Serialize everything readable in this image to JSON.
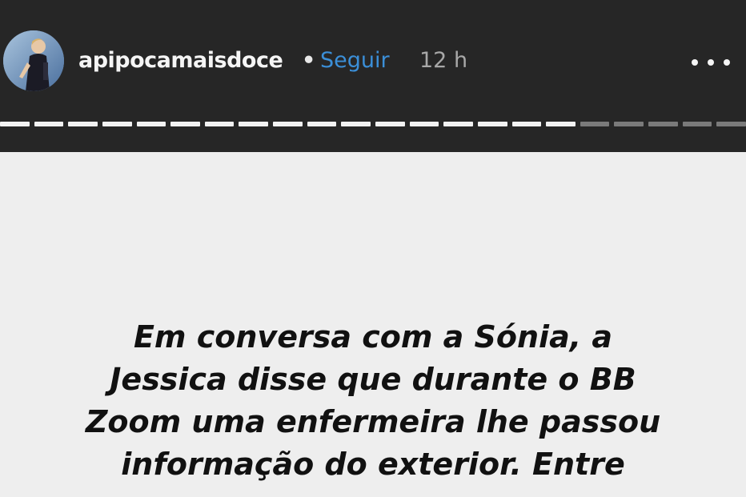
{
  "header": {
    "username": "apipocamaisdoce",
    "separator": "•",
    "follow_label": "Seguir",
    "time": "12 h",
    "more_icon": "more-horizontal-icon"
  },
  "progress": {
    "total_segments": 22,
    "viewed_segments": 17
  },
  "story": {
    "lines": [
      "Em conversa com a Sónia, a",
      "Jessica disse que durante o BB",
      "Zoom uma enfermeira lhe passou",
      "informação do exterior. Entre"
    ]
  },
  "colors": {
    "background": "#262626",
    "story_background": "#eeeeee",
    "follow": "#3b8fd8",
    "progress_viewed": "#f2f2f2",
    "progress_unviewed": "#7a7a7a"
  }
}
